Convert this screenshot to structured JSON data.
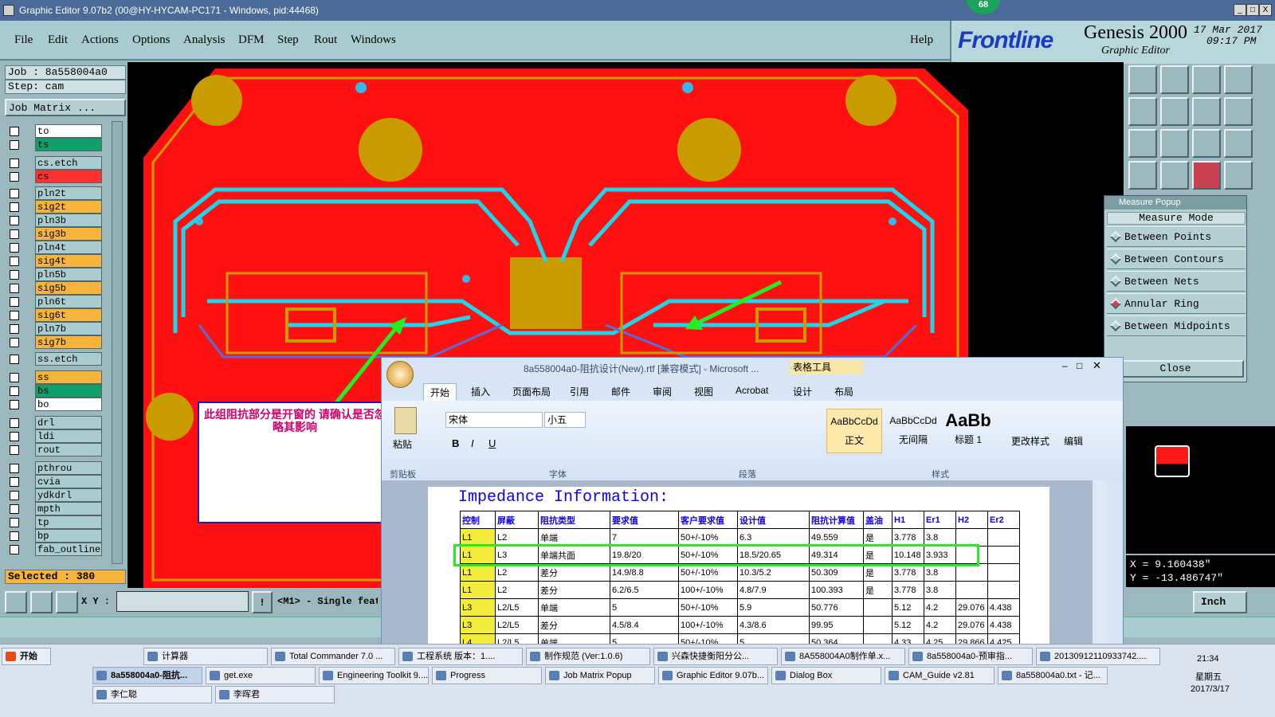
{
  "window": {
    "title": "Graphic Editor 9.07b2 (00@HY-HYCAM-PC171 - Windows, pid:44468)",
    "badge": "68",
    "min_label": "_",
    "max_label": "□",
    "close_label": "X"
  },
  "menu": [
    "File",
    "Edit",
    "Actions",
    "Options",
    "Analysis",
    "DFM",
    "Step",
    "Rout",
    "Windows"
  ],
  "help_label": "Help",
  "brand": {
    "logo": "Frontline",
    "product": "Genesis 2000",
    "subtitle": "Graphic Editor",
    "date": "17 Mar 2017",
    "time": "09:17 PM"
  },
  "job": {
    "job_line": "Job : 8a558004a0",
    "step_line": "Step: cam",
    "matrix_button": "Job Matrix ...",
    "selected": "Selected : 380"
  },
  "layers": [
    {
      "name": "to",
      "color": "#ffffff"
    },
    {
      "name": "ts",
      "color": "#0f9f6a"
    },
    {
      "name": "cs.etch",
      "color": "#a9ccd0"
    },
    {
      "name": "cs",
      "color": "#ff3030"
    },
    {
      "name": "pln2t",
      "color": "#a9ccd0"
    },
    {
      "name": "sig2t",
      "color": "#f7b43a"
    },
    {
      "name": "pln3b",
      "color": "#a9ccd0"
    },
    {
      "name": "sig3b",
      "color": "#f7b43a"
    },
    {
      "name": "pln4t",
      "color": "#a9ccd0"
    },
    {
      "name": "sig4t",
      "color": "#f7b43a"
    },
    {
      "name": "pln5b",
      "color": "#a9ccd0"
    },
    {
      "name": "sig5b",
      "color": "#f7b43a"
    },
    {
      "name": "pln6t",
      "color": "#a9ccd0"
    },
    {
      "name": "sig6t",
      "color": "#f7b43a"
    },
    {
      "name": "pln7b",
      "color": "#a9ccd0"
    },
    {
      "name": "sig7b",
      "color": "#f7b43a"
    },
    {
      "name": "ss.etch",
      "color": "#a9ccd0"
    },
    {
      "name": "ss",
      "color": "#f7b43a"
    },
    {
      "name": "bs",
      "color": "#0f9f6a"
    },
    {
      "name": "bo",
      "color": "#ffffff"
    },
    {
      "name": "drl",
      "color": "#a9ccd0"
    },
    {
      "name": "ldi",
      "color": "#a9ccd0"
    },
    {
      "name": "rout",
      "color": "#a9ccd0"
    },
    {
      "name": "pthrou",
      "color": "#a9ccd0"
    },
    {
      "name": "cvia",
      "color": "#a9ccd0"
    },
    {
      "name": "ydkdrl",
      "color": "#a9ccd0"
    },
    {
      "name": "mpth",
      "color": "#a9ccd0"
    },
    {
      "name": "tp",
      "color": "#a9ccd0"
    },
    {
      "name": "bp",
      "color": "#a9ccd0"
    },
    {
      "name": "fab_outline",
      "color": "#a9ccd0"
    }
  ],
  "measure": {
    "title": "Measure Popup",
    "mode_label": "Measure Mode",
    "options": [
      "Between Points",
      "Between Contours",
      "Between Nets",
      "Annular Ring",
      "Between Midpoints"
    ],
    "close_label": "Close"
  },
  "coords": {
    "x": "X = 9.160438\"",
    "y": "Y = -13.486747\""
  },
  "bottom": {
    "xy_label": "X Y :",
    "input_value": "",
    "mode_text": "<M1> - Single feat",
    "units": "Inch"
  },
  "annotation": "此组阻抗部分是开窗的  请确认是否忽略其影响",
  "word": {
    "title": "8a558004a0-阻抗设计(New).rtf [兼容模式] - Microsoft ...",
    "context_tab": "表格工具",
    "tabs": [
      "开始",
      "插入",
      "页面布局",
      "引用",
      "邮件",
      "审阅",
      "视图",
      "Acrobat",
      "设计",
      "布局"
    ],
    "font_name": "宋体",
    "font_size": "小五",
    "groups": [
      "剪贴板",
      "字体",
      "段落",
      "样式"
    ],
    "paste_label": "粘贴",
    "styles": [
      {
        "sample": "AaBbCcDd",
        "name": "正文"
      },
      {
        "sample": "AaBbCcDd",
        "name": "无间隔"
      },
      {
        "sample": "AaBb",
        "name": "标题 1"
      }
    ],
    "change_style": "更改样式",
    "edit_label": "编辑",
    "doc_heading": "Impedance Information:",
    "table_headers": [
      "控制",
      "屏蔽",
      "阻抗类型",
      "要求值",
      "客户要求值",
      "设计值",
      "阻抗计算值",
      "盖油",
      "H1",
      "Er1",
      "H2",
      "Er2"
    ],
    "table_rows": [
      [
        "L1",
        "L2",
        "单端",
        "7",
        "50+/-10%",
        "6.3",
        "49.559",
        "是",
        "3.778",
        "3.8",
        "",
        ""
      ],
      [
        "L1",
        "L3",
        "单端共面",
        "19.8/20",
        "50+/-10%",
        "18.5/20.65",
        "49.314",
        "是",
        "10.148",
        "3.933",
        "",
        ""
      ],
      [
        "L1",
        "L2",
        "差分",
        "14.9/8.8",
        "50+/-10%",
        "10.3/5.2",
        "50.309",
        "是",
        "3.778",
        "3.8",
        "",
        ""
      ],
      [
        "L1",
        "L2",
        "差分",
        "6.2/6.5",
        "100+/-10%",
        "4.8/7.9",
        "100.393",
        "是",
        "3.778",
        "3.8",
        "",
        ""
      ],
      [
        "L3",
        "L2/L5",
        "单端",
        "5",
        "50+/-10%",
        "5.9",
        "50.776",
        "",
        "5.12",
        "4.2",
        "29.076",
        "4.438"
      ],
      [
        "L3",
        "L2/L5",
        "差分",
        "4.5/8.4",
        "100+/-10%",
        "4.3/8.6",
        "99.95",
        "",
        "5.12",
        "4.2",
        "29.076",
        "4.438"
      ],
      [
        "L4",
        "L2/L5",
        "单端",
        "5",
        "50+/-10%",
        "5",
        "50.364",
        "",
        "4.33",
        "4.25",
        "29.866",
        "4.425"
      ]
    ]
  },
  "taskbar": {
    "start": "开始",
    "row1": [
      "计算器",
      "Total Commander 7.0 ...",
      "工程系统  版本：1....",
      "制作规范 (Ver:1.0.6)",
      "兴森快捷衡阳分公...",
      "8A558004A0制作单.x...",
      "8a558004a0-预审指...",
      "20130912110933742...."
    ],
    "row2": [
      "8a558004a0-阻抗...",
      "get.exe",
      "Engineering Toolkit 9....",
      "Progress",
      "Job Matrix Popup",
      "Graphic Editor 9.07b...",
      "Dialog Box",
      "CAM_Guide v2.81",
      "8a558004a0.txt - 记..."
    ],
    "row3": [
      "李仁聪",
      "李晖君"
    ],
    "clock": "21:34",
    "weekday": "星期五",
    "date": "2017/3/17"
  },
  "colors": {
    "board": "#ff1010",
    "copper": "#c89b00",
    "trace": "#1ed6ec",
    "accent_green": "#22ee22"
  }
}
